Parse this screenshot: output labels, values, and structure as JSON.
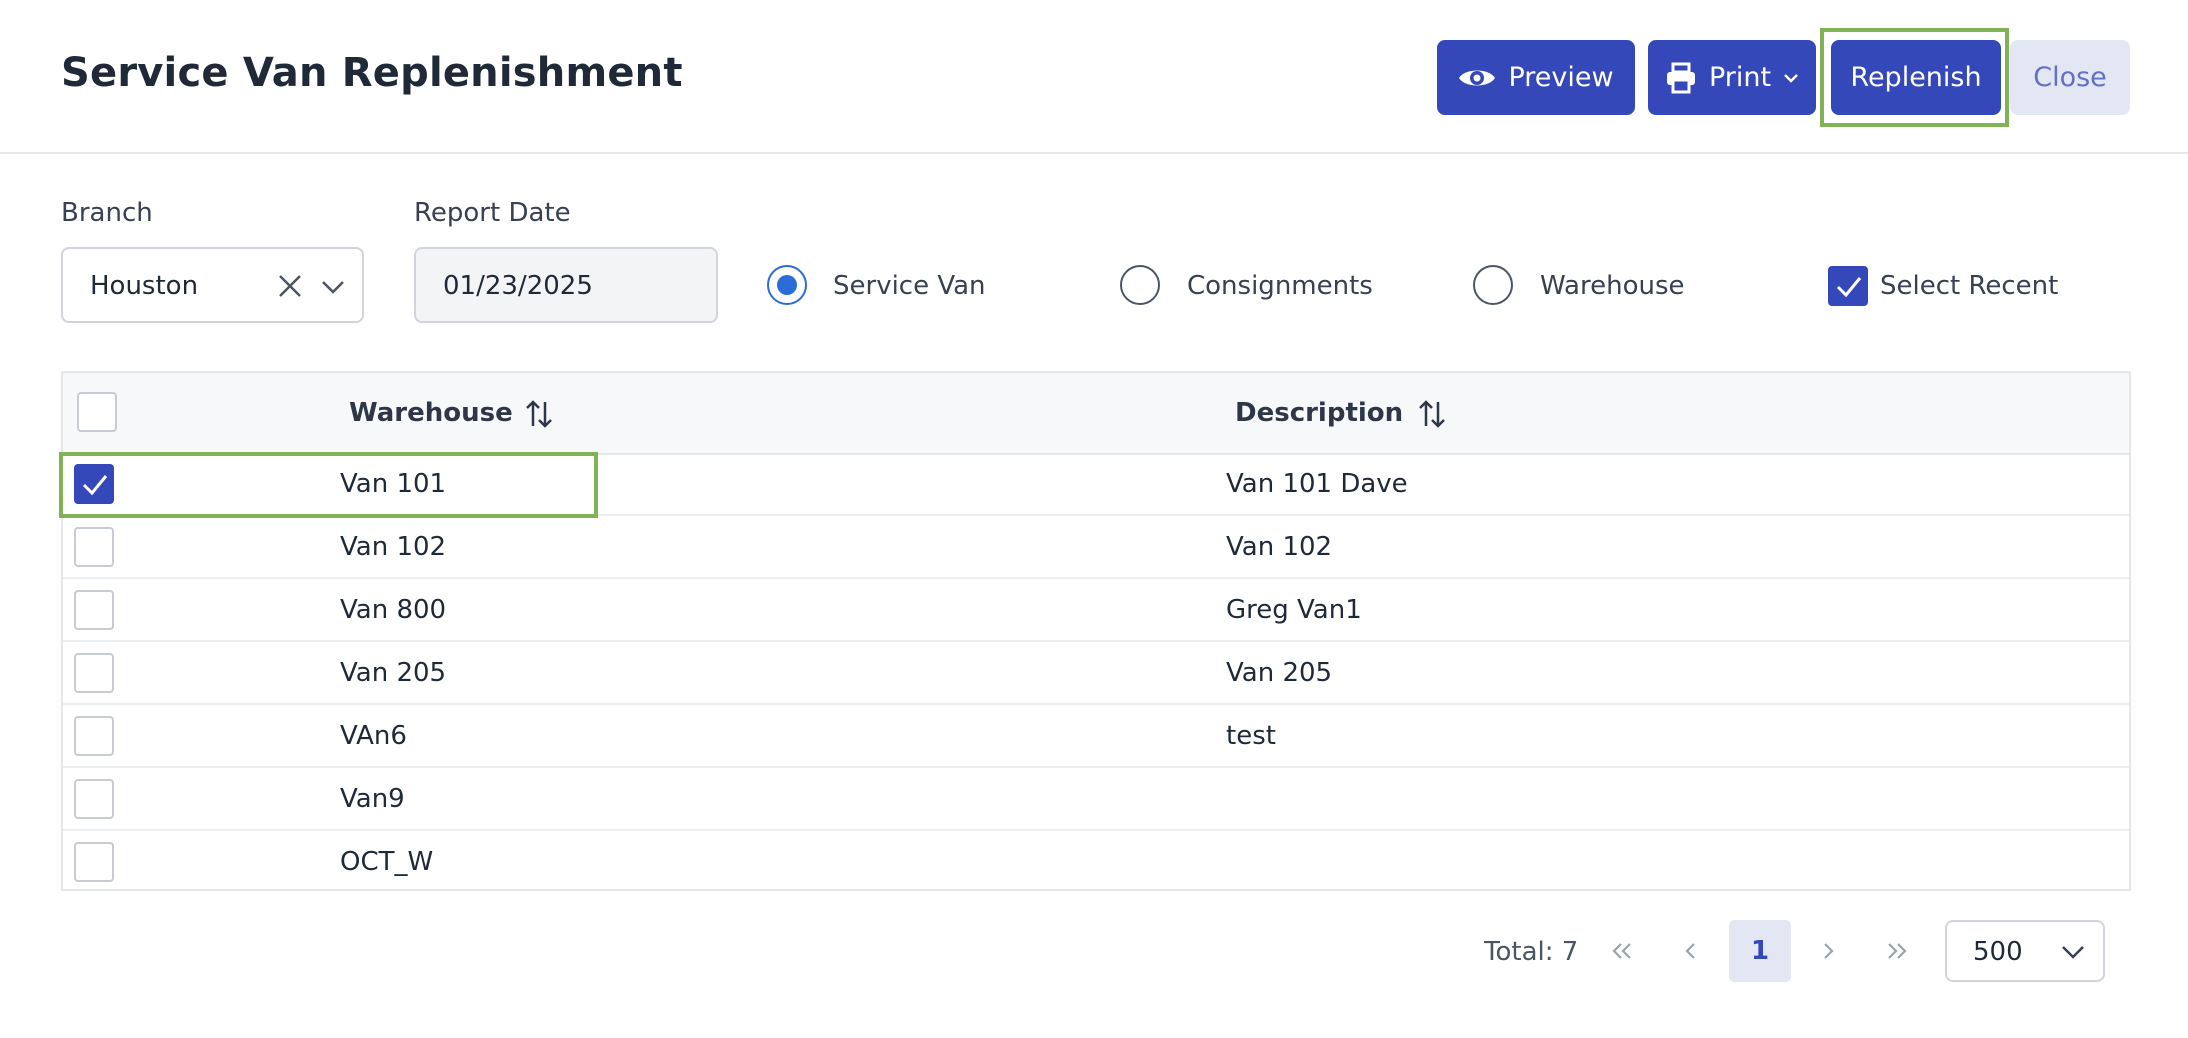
{
  "header": {
    "title": "Service Van Replenishment",
    "buttons": {
      "preview": "Preview",
      "print": "Print",
      "replenish": "Replenish",
      "close": "Close"
    }
  },
  "filters": {
    "branch_label": "Branch",
    "branch_value": "Houston",
    "report_date_label": "Report Date",
    "report_date_value": "01/23/2025",
    "radios": [
      {
        "label": "Service Van",
        "selected": true
      },
      {
        "label": "Consignments",
        "selected": false
      },
      {
        "label": "Warehouse",
        "selected": false
      }
    ],
    "select_recent_label": "Select Recent",
    "select_recent_checked": true
  },
  "table": {
    "columns": [
      "Warehouse",
      "Description"
    ],
    "rows": [
      {
        "warehouse": "Van 101",
        "description": "Van 101 Dave",
        "checked": true
      },
      {
        "warehouse": "Van 102",
        "description": "Van 102",
        "checked": false
      },
      {
        "warehouse": "Van 800",
        "description": "Greg Van1",
        "checked": false
      },
      {
        "warehouse": "Van 205",
        "description": "Van 205",
        "checked": false
      },
      {
        "warehouse": "VAn6",
        "description": "test",
        "checked": false
      },
      {
        "warehouse": "Van9",
        "description": "",
        "checked": false
      },
      {
        "warehouse": "OCT_W",
        "description": "",
        "checked": false
      }
    ]
  },
  "pagination": {
    "total": "Total: 7",
    "current_page": "1",
    "page_size": "500"
  },
  "colors": {
    "primary": "#3548b9",
    "highlight": "#7fb356",
    "radio_accent": "#2b6cd6"
  }
}
